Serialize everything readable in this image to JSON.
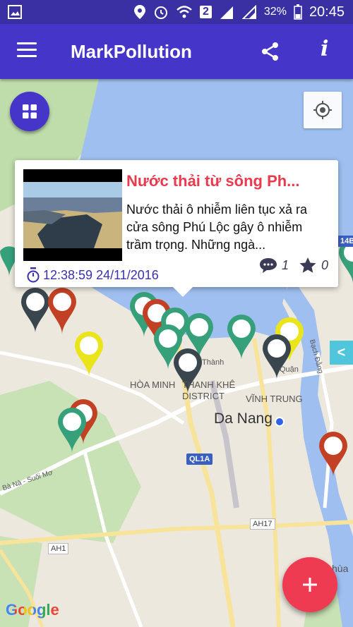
{
  "status": {
    "battery": "32%",
    "time": "20:45",
    "sim": "2"
  },
  "appbar": {
    "title": "MarkPollution"
  },
  "popup": {
    "title": "Nước thải từ sông Ph...",
    "description": "Nước thải ô nhiễm liên tục xả ra cửa sông Phú Lộc gây ô nhiễm trầm trọng. Những ngà...",
    "timestamp": "12:38:59 24/11/2016",
    "comments": "1",
    "stars": "0"
  },
  "map_labels": {
    "hoa_minh": "HÒA MINH",
    "thanh_khe": "THANH KHÊ",
    "district": "DISTRICT",
    "vinh_trung": "VĨNH TRUNG",
    "da_nang": "Da Nang",
    "ql1a": "QL1A",
    "ah17": "AH17",
    "ah1": "AH1",
    "ba_na": "Bà Nà - Suối Mơ",
    "bach_dang": "Bạch Đằng",
    "thanh": "Thành",
    "huan": "Quận",
    "thua": "hùa",
    "ql14b": "14B",
    "edge_tab": "<",
    "google": "Google"
  },
  "colors": {
    "statusbar": "#3a2fa3",
    "appbar": "#4535c9",
    "accent_red": "#ef3b52",
    "pin_green": "#35a079",
    "pin_dark": "#39464e",
    "pin_red": "#c24125",
    "pin_yellow": "#e9e51a"
  }
}
